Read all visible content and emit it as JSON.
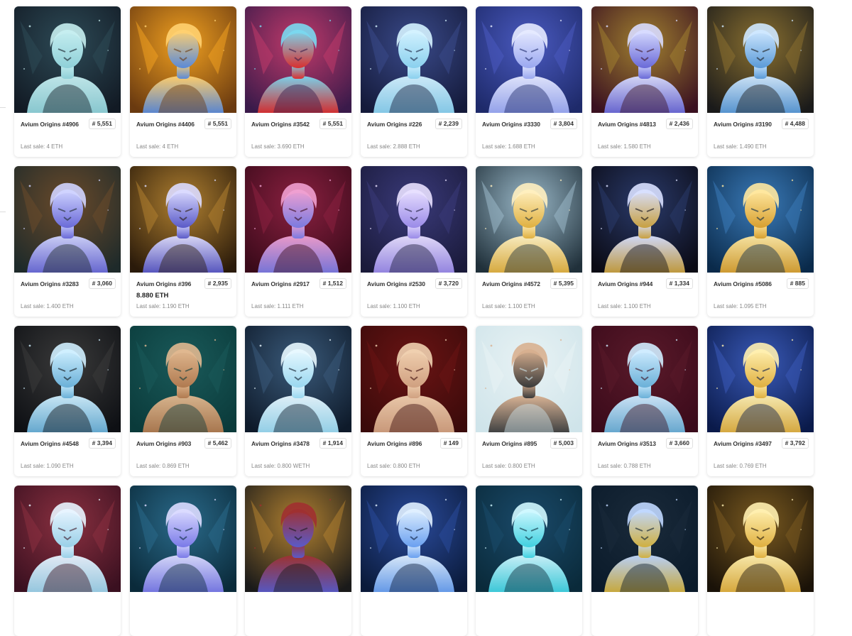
{
  "collection": "Avium Origins",
  "cards": [
    {
      "name": "Avium Origins #4906",
      "rank": "# 5,551",
      "price": "",
      "last_sale": "Last sale: 4 ETH",
      "palette": [
        "#121a24",
        "#2d4a56",
        "#8fd0d8",
        "#c6eef0"
      ]
    },
    {
      "name": "Avium Origins #4406",
      "rank": "# 5,551",
      "price": "",
      "last_sale": "Last sale: 4 ETH",
      "palette": [
        "#6a3a10",
        "#f0a020",
        "#5a8ad8",
        "#ffd070"
      ]
    },
    {
      "name": "Avium Origins #3542",
      "rank": "# 5,551",
      "price": "",
      "last_sale": "Last sale: 3.690 ETH",
      "palette": [
        "#3a1a4a",
        "#c03a6a",
        "#d83030",
        "#7ad8f0"
      ]
    },
    {
      "name": "Avium Origins #226",
      "rank": "# 2,239",
      "price": "",
      "last_sale": "Last sale: 2.888 ETH",
      "palette": [
        "#141a3a",
        "#3a4a8a",
        "#8ad0ee",
        "#d4f2ff"
      ]
    },
    {
      "name": "Avium Origins #3330",
      "rank": "# 3,804",
      "price": "",
      "last_sale": "Last sale: 1.688 ETH",
      "palette": [
        "#1e2a6a",
        "#4a5ac0",
        "#9aa8f0",
        "#e6eaff"
      ]
    },
    {
      "name": "Avium Origins #4813",
      "rank": "# 2,436",
      "price": "",
      "last_sale": "Last sale: 1.580 ETH",
      "palette": [
        "#3a1020",
        "#a08030",
        "#6a6ad8",
        "#d8dcff"
      ]
    },
    {
      "name": "Avium Origins #3190",
      "rank": "# 4,488",
      "price": "",
      "last_sale": "Last sale: 1.490 ETH",
      "palette": [
        "#1a1a1a",
        "#8a7030",
        "#5a9ad8",
        "#cfe8ff"
      ]
    },
    {
      "name": "Avium Origins #3283",
      "rank": "# 3,060",
      "price": "",
      "last_sale": "Last sale: 1.400 ETH",
      "palette": [
        "#1e2a2a",
        "#6a4a2a",
        "#6a6ad8",
        "#d0d4ff"
      ]
    },
    {
      "name": "Avium Origins #396",
      "rank": "# 2,935",
      "price": "8.880 ETH",
      "last_sale": "Last sale: 1.190 ETH",
      "palette": [
        "#2a1a0a",
        "#b08030",
        "#5a5ac8",
        "#dcdcff"
      ]
    },
    {
      "name": "Avium Origins #2917",
      "rank": "# 1,512",
      "price": "",
      "last_sale": "Last sale: 1.111 ETH",
      "palette": [
        "#3a0a1a",
        "#8a2040",
        "#7a7ae0",
        "#f0a0d0"
      ]
    },
    {
      "name": "Avium Origins #2530",
      "rank": "# 3,720",
      "price": "",
      "last_sale": "Last sale: 1.100 ETH",
      "palette": [
        "#1a1a3a",
        "#3a3a7a",
        "#9a8ae8",
        "#e8e0ff"
      ]
    },
    {
      "name": "Avium Origins #4572",
      "rank": "# 5,395",
      "price": "",
      "last_sale": "Last sale: 1.100 ETH",
      "palette": [
        "#20303a",
        "#9ab8c8",
        "#e0b040",
        "#fff0c0"
      ]
    },
    {
      "name": "Avium Origins #944",
      "rank": "# 1,334",
      "price": "",
      "last_sale": "Last sale: 1.100 ETH",
      "palette": [
        "#0a0a14",
        "#2a3a6a",
        "#c8a040",
        "#d8e0ff"
      ]
    },
    {
      "name": "Avium Origins #5086",
      "rank": "# 885",
      "price": "",
      "last_sale": "Last sale: 1.095 ETH",
      "palette": [
        "#0a2a4a",
        "#3a7ab8",
        "#d8a030",
        "#ffe8a0"
      ]
    },
    {
      "name": "Avium Origins #4548",
      "rank": "# 3,394",
      "price": "",
      "last_sale": "Last sale: 1.090 ETH",
      "palette": [
        "#0e1014",
        "#3a3a3a",
        "#6ab0d8",
        "#d0f0ff"
      ]
    },
    {
      "name": "Avium Origins #903",
      "rank": "# 5,462",
      "price": "",
      "last_sale": "Last sale: 0.869 ETH",
      "palette": [
        "#0a3a3a",
        "#1a5a5a",
        "#b07a50",
        "#e0b890"
      ]
    },
    {
      "name": "Avium Origins #3478",
      "rank": "# 1,914",
      "price": "",
      "last_sale": "Last sale: 0.800 WETH",
      "palette": [
        "#0e1a2a",
        "#3a5a7a",
        "#9ad8f0",
        "#e8f8ff"
      ]
    },
    {
      "name": "Avium Origins #896",
      "rank": "# 149",
      "price": "",
      "last_sale": "Last sale: 0.800 ETH",
      "palette": [
        "#3a0a0a",
        "#6a1414",
        "#d0a080",
        "#f0d0b0"
      ]
    },
    {
      "name": "Avium Origins #895",
      "rank": "# 5,003",
      "price": "",
      "last_sale": "Last sale: 0.800 ETH",
      "palette": [
        "#cfe4ea",
        "#e8f2f4",
        "#3a3a3a",
        "#d8b090"
      ]
    },
    {
      "name": "Avium Origins #3513",
      "rank": "# 3,660",
      "price": "",
      "last_sale": "Last sale: 0.788 ETH",
      "palette": [
        "#3a0a1a",
        "#5a1a2a",
        "#6ab0d8",
        "#d0ecff"
      ]
    },
    {
      "name": "Avium Origins #3497",
      "rank": "# 3,792",
      "price": "",
      "last_sale": "Last sale: 0.769 ETH",
      "palette": [
        "#0a1a4a",
        "#3a5ab8",
        "#e0b040",
        "#fff0b0"
      ]
    },
    {
      "name": "",
      "rank": "",
      "price": "",
      "last_sale": "",
      "palette": [
        "#3a1020",
        "#8a3040",
        "#9ad0e8",
        "#e8f4ff"
      ]
    },
    {
      "name": "",
      "rank": "",
      "price": "",
      "last_sale": "",
      "palette": [
        "#0a2a3a",
        "#2a6a8a",
        "#7a7ae8",
        "#dcdcff"
      ]
    },
    {
      "name": "",
      "rank": "",
      "price": "",
      "last_sale": "",
      "palette": [
        "#1a1a1a",
        "#b08030",
        "#5a5ac8",
        "#a03030"
      ]
    },
    {
      "name": "",
      "rank": "",
      "price": "",
      "last_sale": "",
      "palette": [
        "#0a1a3a",
        "#2a4a9a",
        "#6aa0f0",
        "#e0f0ff"
      ]
    },
    {
      "name": "",
      "rank": "",
      "price": "",
      "last_sale": "",
      "palette": [
        "#0a2a3a",
        "#1a4a6a",
        "#40d0e0",
        "#d0f8ff"
      ]
    },
    {
      "name": "",
      "rank": "",
      "price": "",
      "last_sale": "",
      "palette": [
        "#0a1a2a",
        "#1a2a3a",
        "#d0b040",
        "#c0d8ff"
      ]
    },
    {
      "name": "",
      "rank": "",
      "price": "",
      "last_sale": "",
      "palette": [
        "#1a1208",
        "#7a5a20",
        "#e0b040",
        "#fff0b0"
      ]
    }
  ]
}
